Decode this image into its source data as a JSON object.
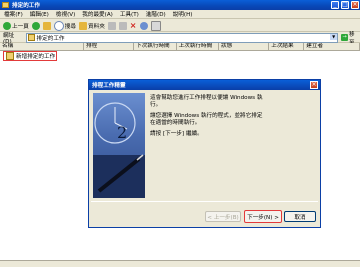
{
  "window": {
    "title": "排定的工作"
  },
  "menu": [
    "檔案(F)",
    "編輯(E)",
    "檢視(V)",
    "我的最愛(A)",
    "工具(T)",
    "進階(D)",
    "說明(H)"
  ],
  "toolbar": {
    "back": "上一頁",
    "search": "搜尋",
    "folders": "資料夾"
  },
  "address": {
    "label": "網址(D)",
    "value": "排定的工作",
    "go": "移至"
  },
  "columns": [
    "名稱",
    "排程",
    "下次執行時間",
    "上次執行時間",
    "狀態",
    "上次結果",
    "建立者"
  ],
  "items": [
    {
      "label": "新增排定的工作"
    }
  ],
  "wizard": {
    "title": "排程工作精靈",
    "p1": "這會幫助您進行工作排程以便讓 Windows 執\n行。",
    "p2": "讓您選擇 Windows 執行的程式，並將它排定\n在適當的時間執行。",
    "p3": "請按 [下一步] 繼續。",
    "back_button": "< 上一步(B)",
    "next_button": "下一步(N) >",
    "cancel_button": "取消"
  }
}
